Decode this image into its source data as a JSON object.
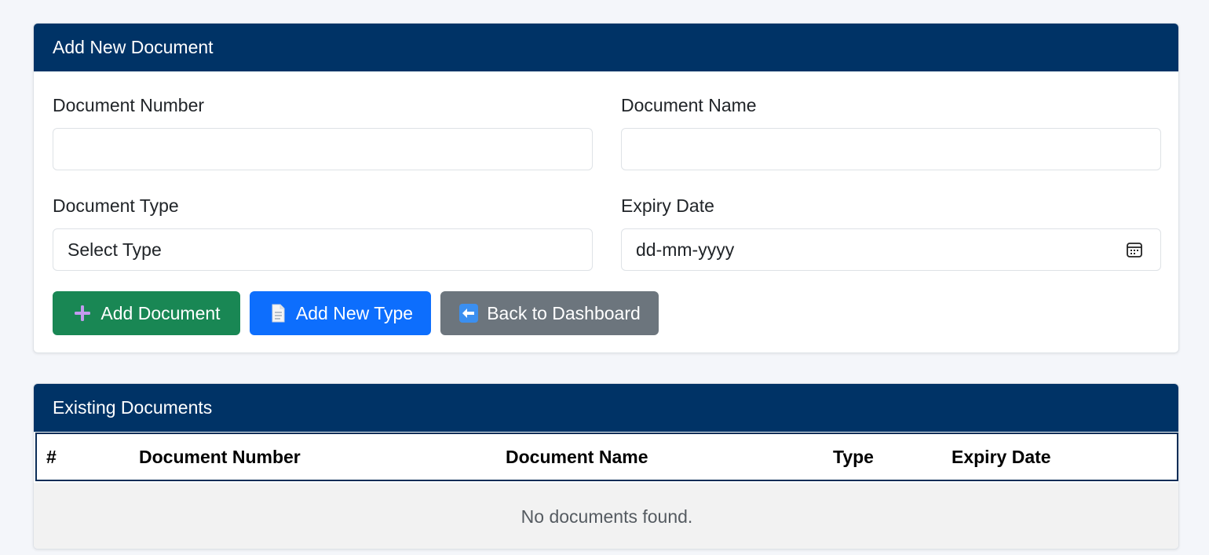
{
  "form_card": {
    "title": "Add New Document",
    "fields": {
      "document_number": {
        "label": "Document Number",
        "value": ""
      },
      "document_name": {
        "label": "Document Name",
        "value": ""
      },
      "document_type": {
        "label": "Document Type",
        "selected": "Select Type"
      },
      "expiry_date": {
        "label": "Expiry Date",
        "placeholder": "dd-mm-yyyy",
        "icon": "calendar-icon"
      }
    },
    "buttons": {
      "add_document": {
        "label": "Add Document",
        "icon": "plus-icon",
        "color": "#198754"
      },
      "add_new_type": {
        "label": "Add New Type",
        "icon": "page-icon",
        "color": "#0d6efd"
      },
      "back_to_dashboard": {
        "label": "Back to Dashboard",
        "icon": "left-arrow-icon",
        "color": "#6c757d"
      }
    }
  },
  "table_card": {
    "title": "Existing Documents",
    "columns": [
      "#",
      "Document Number",
      "Document Name",
      "Type",
      "Expiry Date"
    ],
    "empty_message": "No documents found."
  },
  "colors": {
    "header_bg": "#003366",
    "page_bg": "#f4f6fa"
  }
}
